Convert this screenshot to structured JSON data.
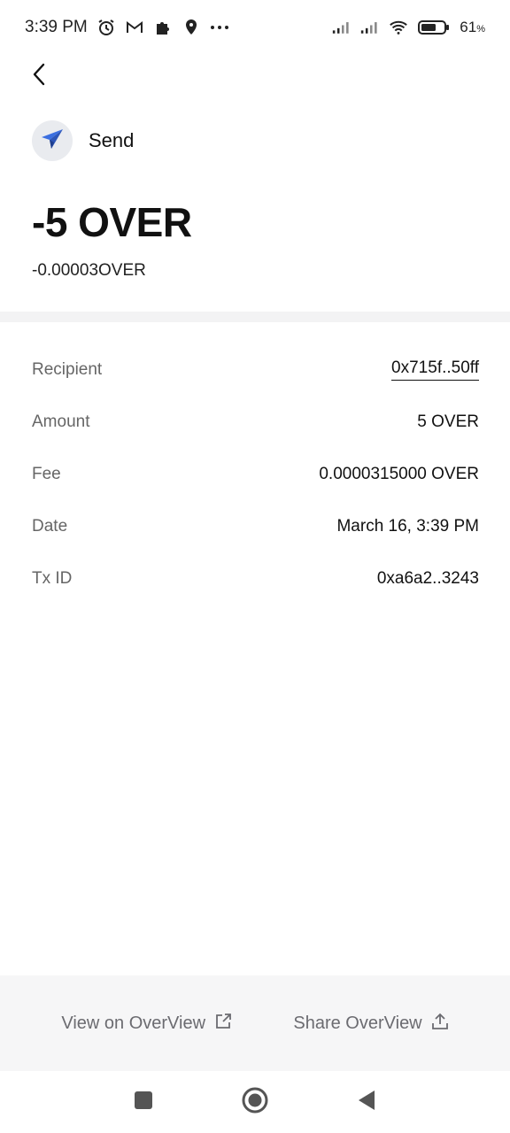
{
  "status_bar": {
    "time": "3:39 PM",
    "battery_percent": "61",
    "battery_unit": "%",
    "icons": [
      "alarm-icon",
      "gmail-icon",
      "puzzle-icon",
      "location-icon",
      "more-dots-icon",
      "signal-icon",
      "signal-icon",
      "wifi-icon",
      "battery-icon"
    ]
  },
  "header": {
    "back_icon": "chevron-left-icon",
    "type_icon": "paper-plane-icon",
    "type_label": "Send"
  },
  "amount": {
    "main": "-5 OVER",
    "sub": "-0.00003OVER"
  },
  "details": [
    {
      "label": "Recipient",
      "value": "0x715f..50ff"
    },
    {
      "label": "Amount",
      "value": "5 OVER"
    },
    {
      "label": "Fee",
      "value": "0.0000315000 OVER"
    },
    {
      "label": "Date",
      "value": "March 16, 3:39 PM"
    },
    {
      "label": "Tx ID",
      "value": "0xa6a2..3243"
    }
  ],
  "actions": {
    "view_label": "View on OverView",
    "view_icon": "external-link-icon",
    "share_label": "Share OverView",
    "share_icon": "share-upload-icon"
  },
  "nav": {
    "icons": [
      "recent-apps-icon",
      "home-icon",
      "back-triangle-icon"
    ]
  },
  "colors": {
    "accent_plane": "#3b6fe0",
    "divider_band": "#f3f3f4",
    "action_bar_bg": "#f6f6f7",
    "label_gray": "#666666"
  }
}
